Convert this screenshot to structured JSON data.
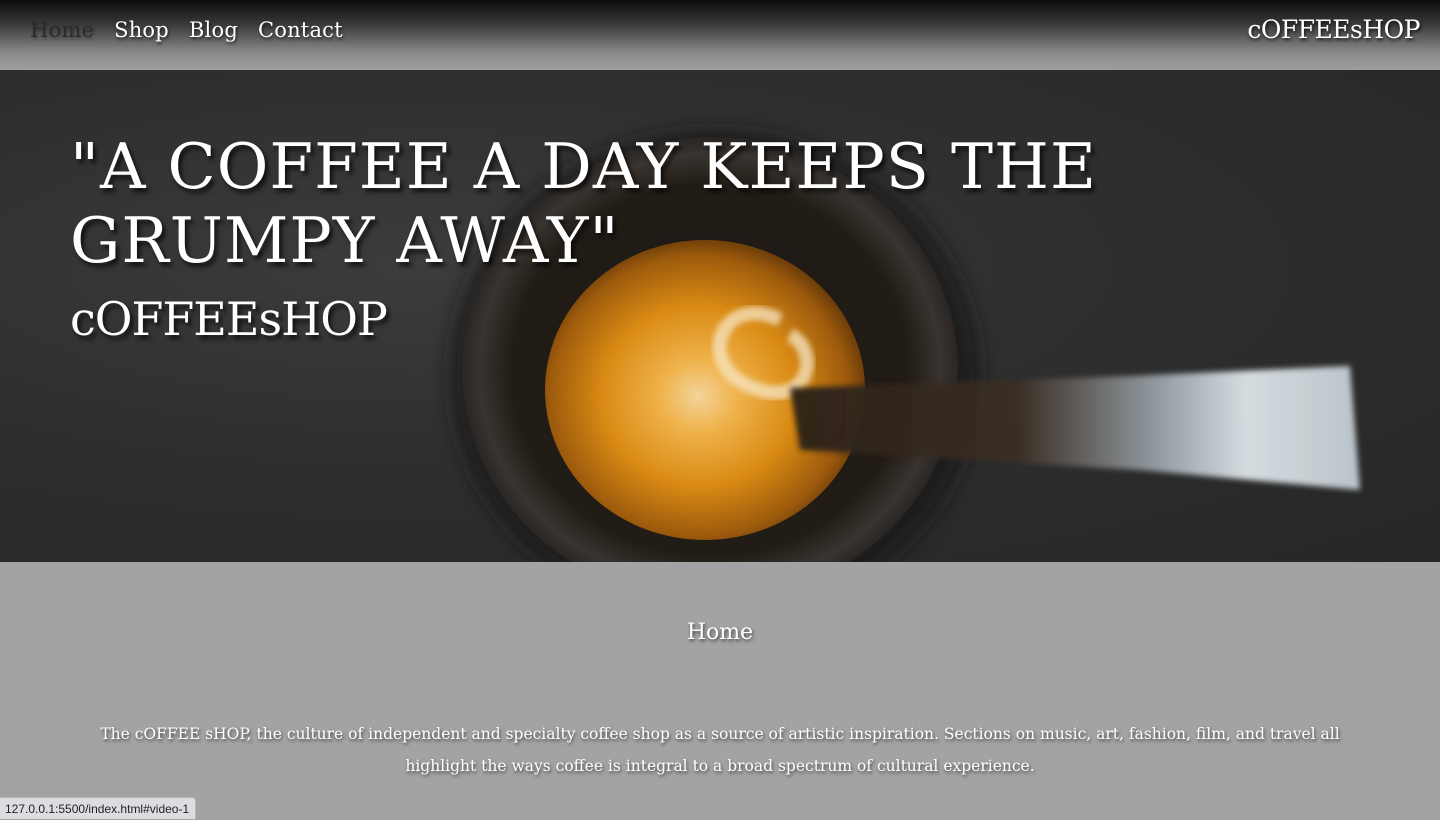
{
  "nav": {
    "links": [
      "Home",
      "Shop",
      "Blog",
      "Contact"
    ],
    "active": "Home",
    "brand": "cOFFEEsHOP"
  },
  "hero": {
    "quote": "\"A COFFEE A DAY KEEPS THE GRUMPY AWAY\"",
    "subtitle": "cOFFEEsHOP"
  },
  "section": {
    "title": "Home",
    "text": "The cOFFEE sHOP, the culture of independent and specialty coffee shop as a source of artistic inspiration. Sections on music, art, fashion, film, and travel all highlight the ways coffee is integral to a broad spectrum of cultural experience."
  },
  "status_bar": {
    "url": "127.0.0.1:5500/index.html#video-1"
  },
  "colors": {
    "content_bg": "#a3a3a3",
    "hero_bg": "#2f2f2f",
    "espresso": "#d98a14",
    "text": "#ffffff"
  }
}
